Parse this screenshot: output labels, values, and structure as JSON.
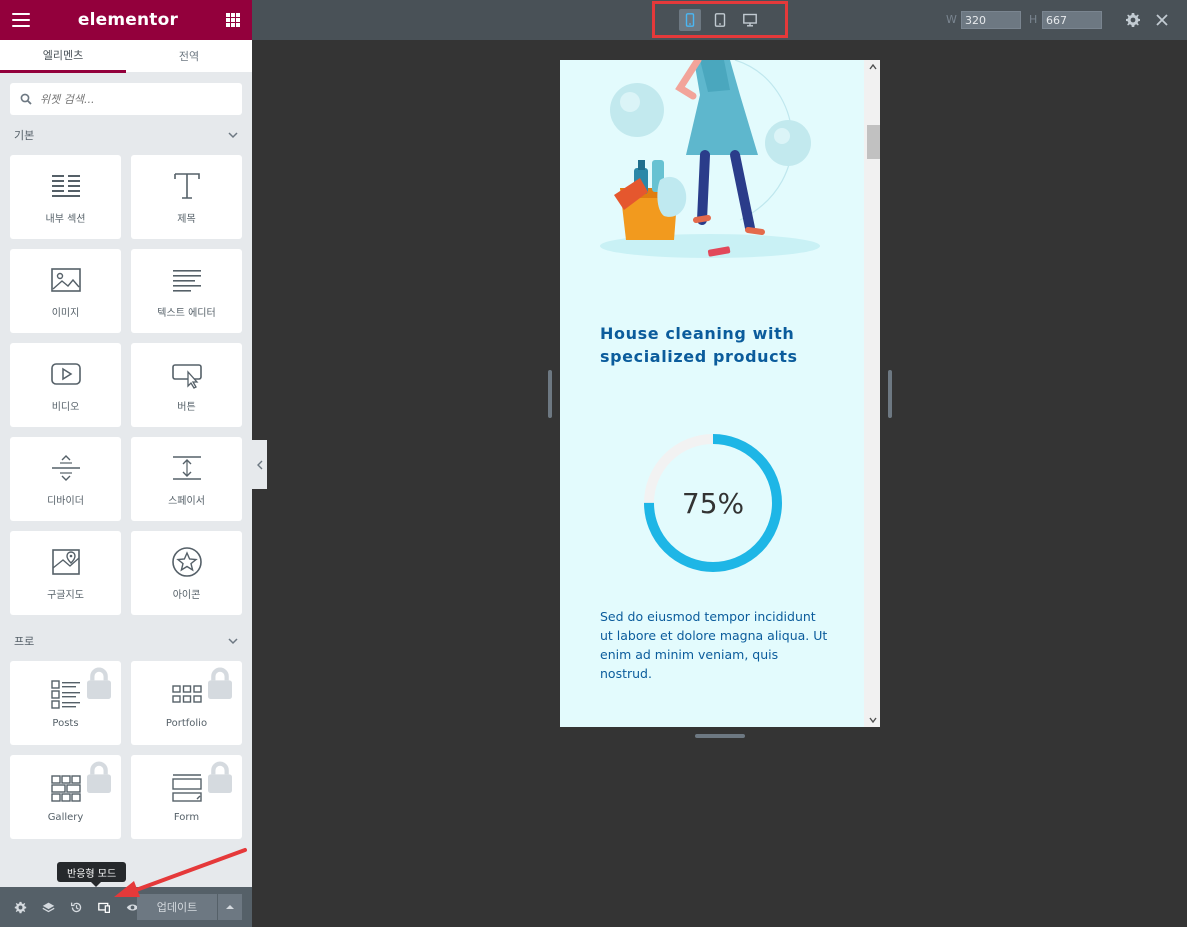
{
  "panel": {
    "brand": "elementor",
    "tabs": [
      {
        "label": "엘리멘츠",
        "active": true
      },
      {
        "label": "전역",
        "active": false
      }
    ],
    "search_placeholder": "위젯 검색...",
    "categories": [
      {
        "label": "기본",
        "widgets": [
          {
            "label": "내부 섹션",
            "icon": "inner-section-icon"
          },
          {
            "label": "제목",
            "icon": "heading-icon"
          },
          {
            "label": "이미지",
            "icon": "image-icon"
          },
          {
            "label": "텍스트 에디터",
            "icon": "text-editor-icon"
          },
          {
            "label": "비디오",
            "icon": "video-icon"
          },
          {
            "label": "버튼",
            "icon": "button-icon"
          },
          {
            "label": "디바이더",
            "icon": "divider-icon"
          },
          {
            "label": "스페이서",
            "icon": "spacer-icon"
          },
          {
            "label": "구글지도",
            "icon": "google-maps-icon"
          },
          {
            "label": "아이콘",
            "icon": "star-icon"
          }
        ]
      },
      {
        "label": "프로",
        "widgets": [
          {
            "label": "Posts",
            "icon": "posts-icon",
            "locked": true
          },
          {
            "label": "Portfolio",
            "icon": "portfolio-icon",
            "locked": true
          },
          {
            "label": "Gallery",
            "icon": "gallery-icon",
            "locked": true
          },
          {
            "label": "Form",
            "icon": "form-icon",
            "locked": true
          }
        ]
      }
    ],
    "footer": {
      "tooltip": "반응형 모드",
      "update_label": "업데이트"
    }
  },
  "topbar": {
    "width_label": "W",
    "width_value": "320",
    "height_label": "H",
    "height_value": "667",
    "active_device": "mobile"
  },
  "preview": {
    "heading": "House cleaning with specialized products",
    "progress_value": 75,
    "progress_text": "75%",
    "body": "Sed do eiusmod tempor incididunt ut labore et dolore magna aliqua. Ut enim ad minim veniam, quis nostrud.",
    "colors": {
      "background": "#e3fbfd",
      "accent": "#1eb6e6",
      "heading": "#0b5c9c"
    }
  },
  "colors": {
    "brand": "#93003c",
    "highlight": "#e5393a"
  }
}
